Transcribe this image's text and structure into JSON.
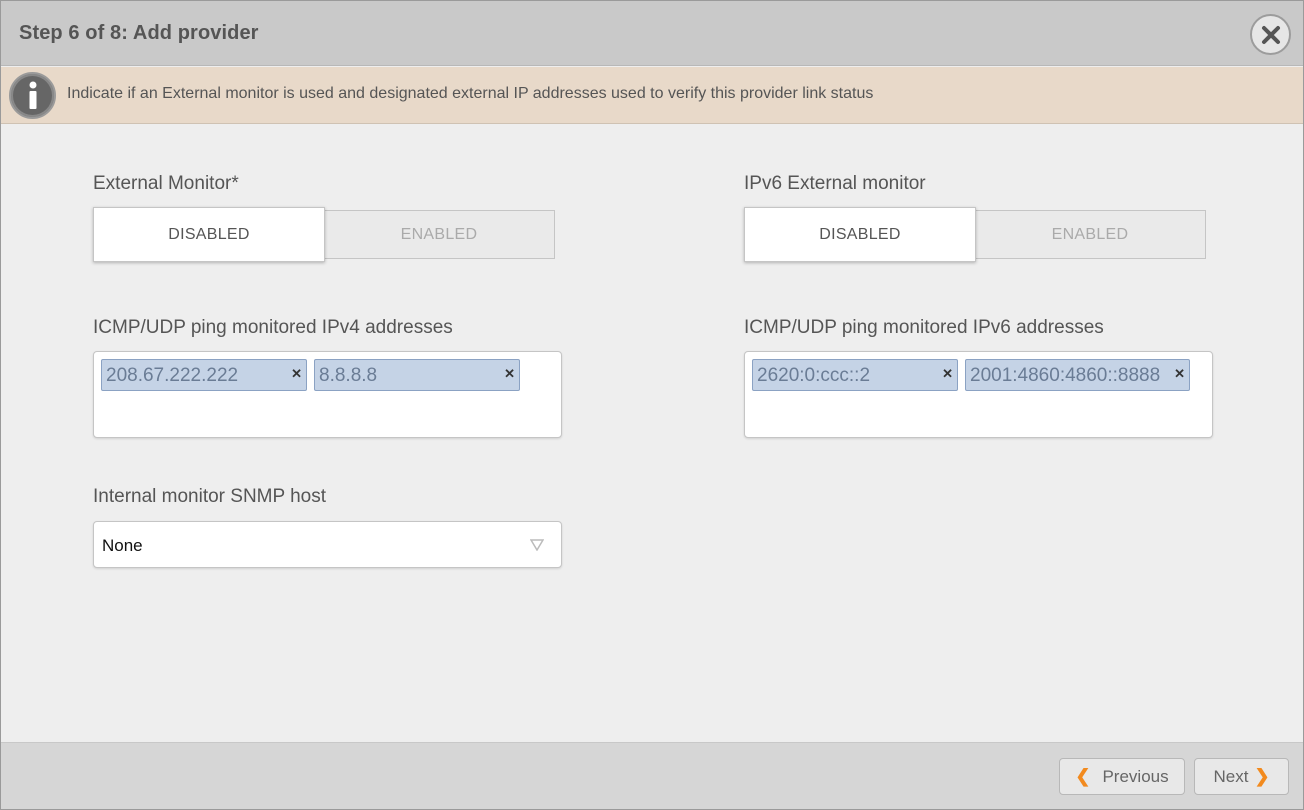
{
  "dialog": {
    "title": "Step 6 of 8: Add provider"
  },
  "info": {
    "text": "Indicate if an External monitor is used and designated external IP addresses used to verify this provider link status"
  },
  "external_monitor": {
    "label": "External Monitor*",
    "options": [
      "DISABLED",
      "ENABLED"
    ],
    "selected": "DISABLED"
  },
  "ipv6_external_monitor": {
    "label": "IPv6 External monitor",
    "options": [
      "DISABLED",
      "ENABLED"
    ],
    "selected": "DISABLED"
  },
  "ipv4_addresses": {
    "label": "ICMP/UDP ping monitored IPv4 addresses",
    "tags": [
      "208.67.222.222",
      "8.8.8.8"
    ]
  },
  "ipv6_addresses": {
    "label": "ICMP/UDP ping monitored IPv6 addresses",
    "tags": [
      "2620:0:ccc::2",
      "2001:4860:4860::8888"
    ]
  },
  "snmp_host": {
    "label": "Internal monitor SNMP host",
    "value": "None"
  },
  "footer": {
    "previous_label": "Previous",
    "next_label": "Next"
  },
  "colors": {
    "header_bg": "#c9c9c9",
    "info_bg": "#e8d9c9",
    "tag_bg": "#c5d3e6",
    "accent_chevron": "#f28a1e"
  },
  "icons": [
    "close-icon",
    "info-icon",
    "tag-remove-icon",
    "dropdown-arrow-icon",
    "chevron-left-icon",
    "chevron-right-icon"
  ]
}
